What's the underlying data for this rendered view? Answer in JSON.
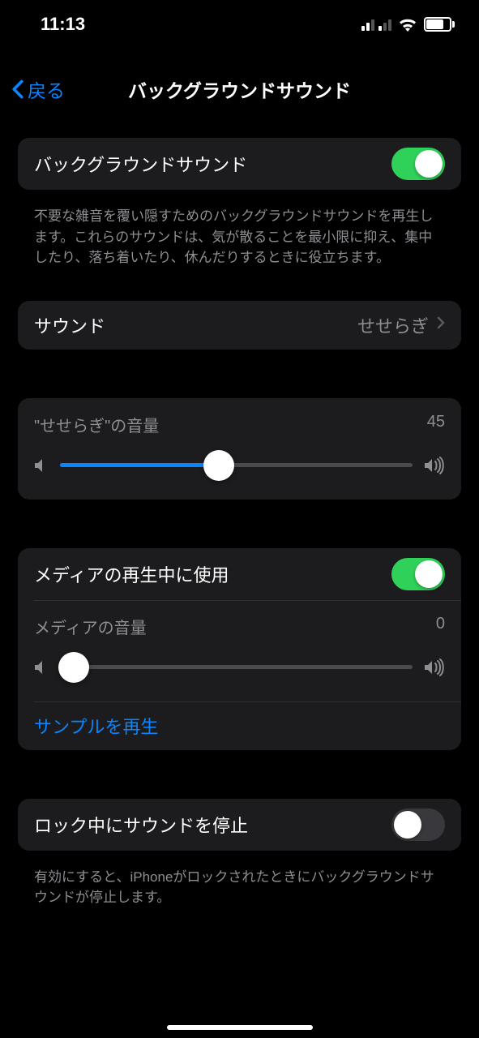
{
  "status": {
    "time": "11:13",
    "battery_pct": "76",
    "battery_fill_pct": 76
  },
  "nav": {
    "back": "戻る",
    "title": "バックグラウンドサウンド"
  },
  "main_toggle": {
    "label": "バックグラウンドサウンド",
    "on": true
  },
  "main_desc": "不要な雑音を覆い隠すためのバックグラウンドサウンドを再生します。これらのサウンドは、気が散ることを最小限に抑え、集中したり、落ち着いたり、休んだりするときに役立ちます。",
  "sound_row": {
    "label": "サウンド",
    "value": "せせらぎ"
  },
  "volume1": {
    "label": "\"せせらぎ\"の音量",
    "value": "45",
    "pct": 45
  },
  "media_toggle": {
    "label": "メディアの再生中に使用",
    "on": true
  },
  "volume2": {
    "label": "メディアの音量",
    "value": "0",
    "pct": 4
  },
  "sample_link": "サンプルを再生",
  "lock_toggle": {
    "label": "ロック中にサウンドを停止",
    "on": false
  },
  "lock_desc": "有効にすると、iPhoneがロックされたときにバックグラウンドサウンドが停止します。"
}
